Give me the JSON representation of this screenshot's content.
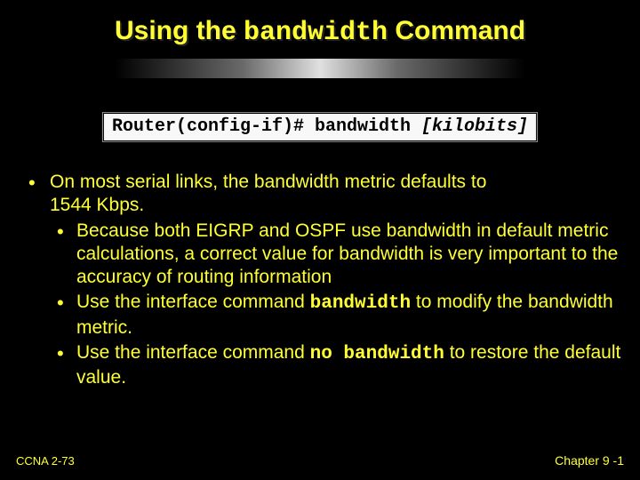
{
  "title": {
    "prefix": "Using the ",
    "code": "bandwidth",
    "suffix": " Command"
  },
  "command": {
    "prompt": "Router(config-if)# bandwidth ",
    "arg": "[kilobits]"
  },
  "bullets": {
    "b1_a": "On most serial links, the bandwidth metric defaults to",
    "b1_b": "1544 Kbps.",
    "b1s1": "Because both EIGRP and OSPF use bandwidth in default metric calculations, a correct value for bandwidth is very important to the accuracy of routing information",
    "b1s2_a": "Use the interface command ",
    "b1s2_code": "bandwidth",
    "b1s2_b": " to modify the bandwidth metric.",
    "b1s3_a": "Use the interface command ",
    "b1s3_code": "no bandwidth",
    "b1s3_b": " to restore the default value."
  },
  "footer": {
    "left": "CCNA 2-73",
    "right": "Chapter  9 -1"
  }
}
